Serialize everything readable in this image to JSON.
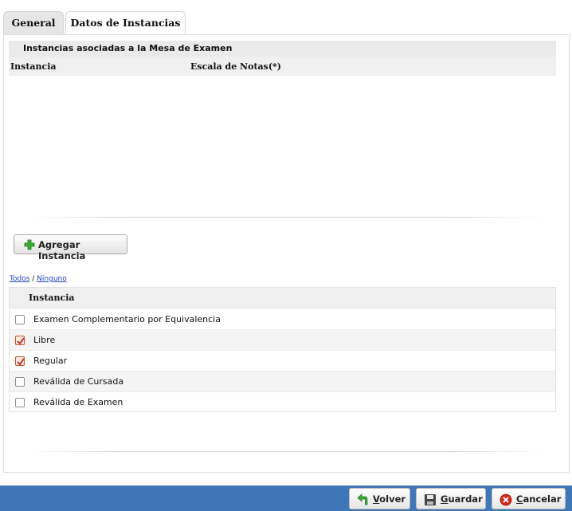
{
  "tabs": [
    {
      "label": "General",
      "active": false
    },
    {
      "label": "Datos de Instancias",
      "active": true
    }
  ],
  "instances_grid": {
    "title": "Instancias asociadas a la Mesa de Examen",
    "columns": [
      "Instancia",
      "Escala de Notas(*)"
    ],
    "rows": []
  },
  "add_button": {
    "label": "Agregar Instancia",
    "icon": "green-plus-icon"
  },
  "select_links": {
    "all": "Todos",
    "separator": "/",
    "none": "Ninguno"
  },
  "instance_list": {
    "header": "Instancia",
    "items": [
      {
        "label": "Examen Complementario por Equivalencia",
        "checked": false
      },
      {
        "label": "Libre",
        "checked": true
      },
      {
        "label": "Regular",
        "checked": true
      },
      {
        "label": "Reválida de Cursada",
        "checked": false
      },
      {
        "label": "Reválida de Examen",
        "checked": false
      }
    ]
  },
  "footer": {
    "volver": {
      "prefix": "",
      "underline": "V",
      "rest": "olver",
      "icon": "green-back-arrow-icon"
    },
    "guardar": {
      "prefix": "",
      "underline": "G",
      "rest": "uardar",
      "icon": "floppy-disk-icon"
    },
    "cancelar": {
      "prefix": "",
      "underline": "C",
      "rest": "ancelar",
      "icon": "red-cancel-icon"
    }
  },
  "colors": {
    "footer_bar": "#3e76b7",
    "checkbox_checked": "#c0582d",
    "link": "#2344b8"
  }
}
